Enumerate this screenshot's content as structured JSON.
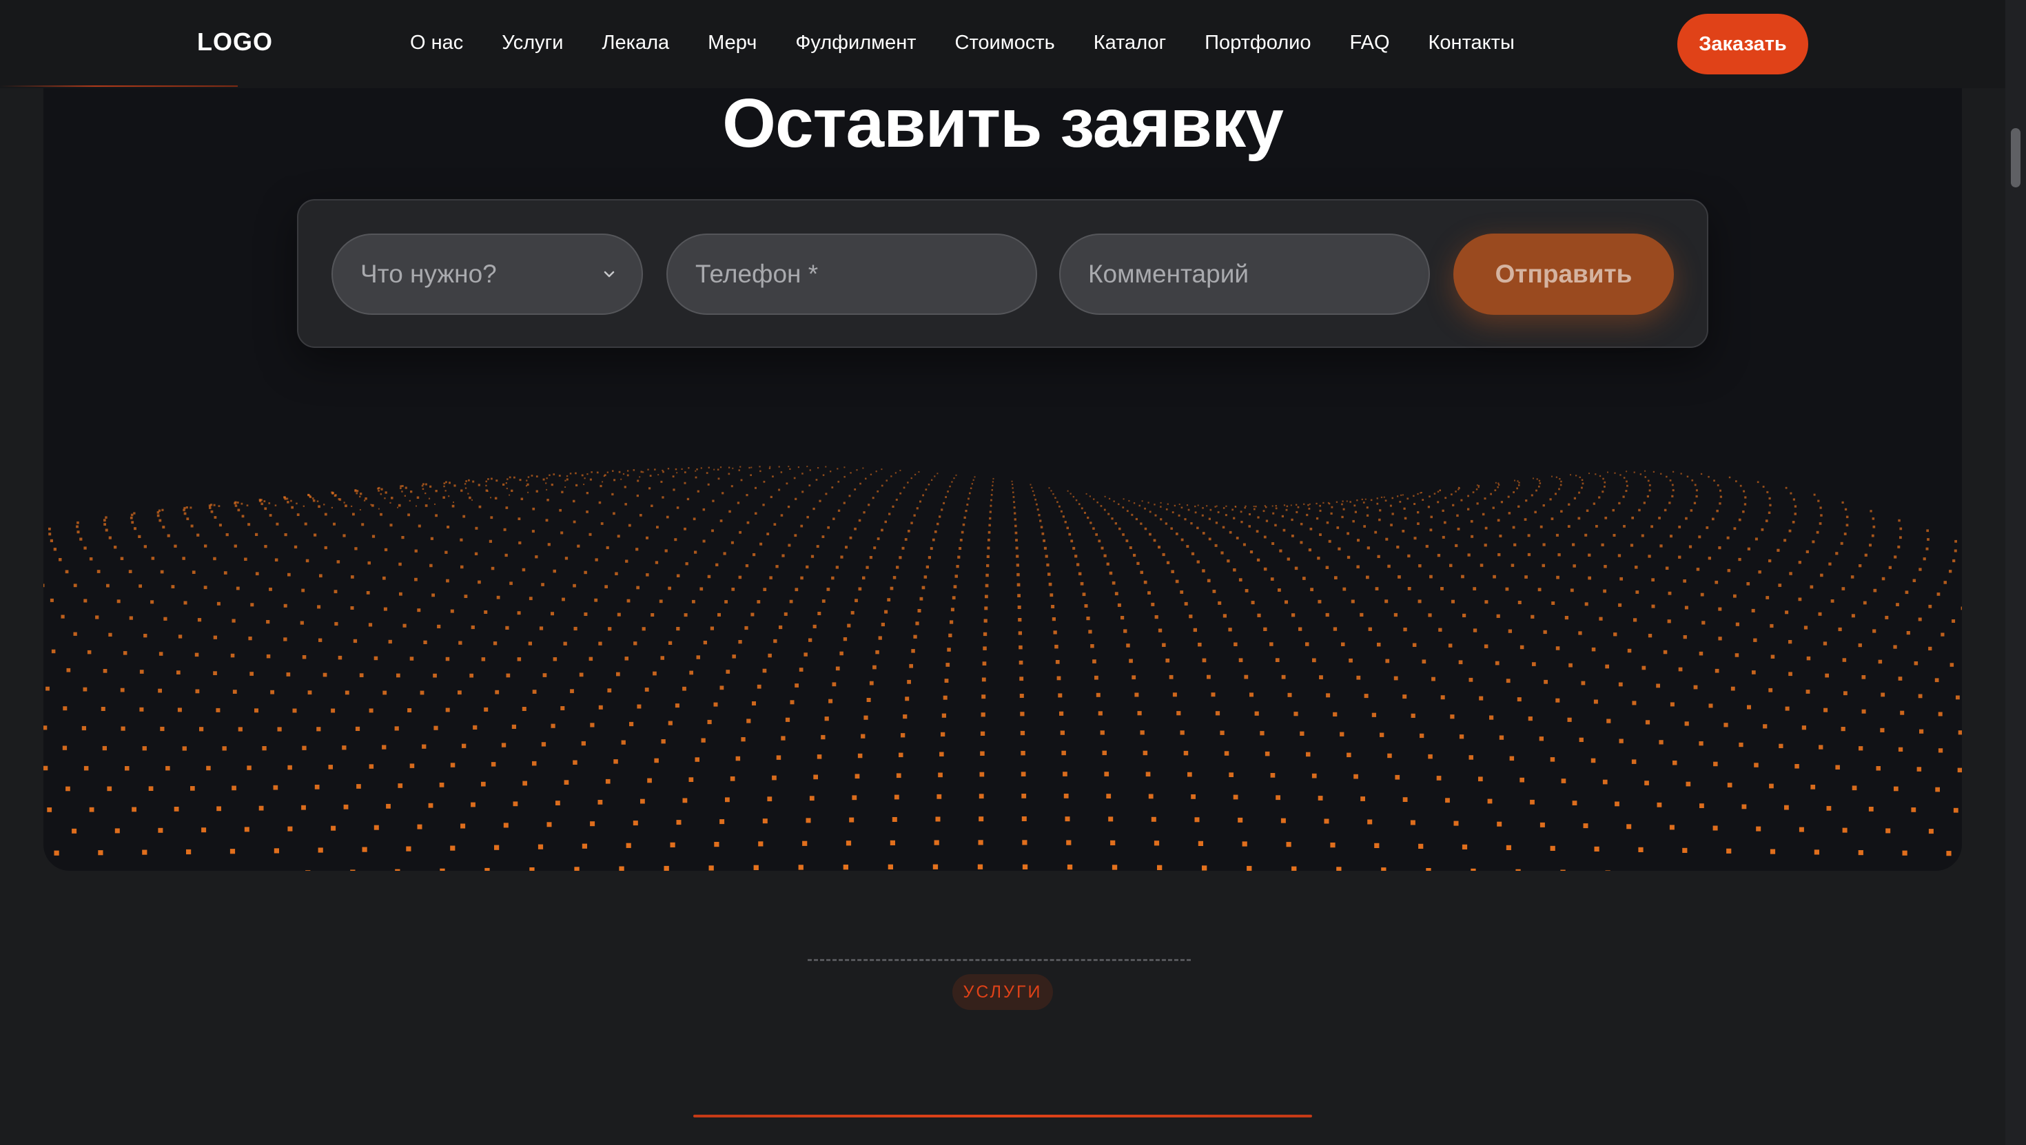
{
  "header": {
    "logo": "LOGO",
    "nav": [
      {
        "label": "О нас"
      },
      {
        "label": "Услуги"
      },
      {
        "label": "Лекала"
      },
      {
        "label": "Мерч"
      },
      {
        "label": "Фулфилмент"
      },
      {
        "label": "Стоимость"
      },
      {
        "label": "Каталог"
      },
      {
        "label": "Портфолио"
      },
      {
        "label": "FAQ"
      },
      {
        "label": "Контакты"
      }
    ],
    "cta_label": "Заказать"
  },
  "hero": {
    "title": "Оставить заявку",
    "form": {
      "select_placeholder": "Что нужно?",
      "phone_placeholder": "Телефон *",
      "comment_placeholder": "Комментарий",
      "submit_label": "Отправить"
    }
  },
  "services": {
    "badge": "УСЛУГИ"
  },
  "colors": {
    "accent": "#e04218",
    "dots": "#e8731e",
    "background": "#1b1c1e",
    "card": "#111216"
  },
  "icons": {
    "select_chevron": "chevron-down-icon"
  }
}
